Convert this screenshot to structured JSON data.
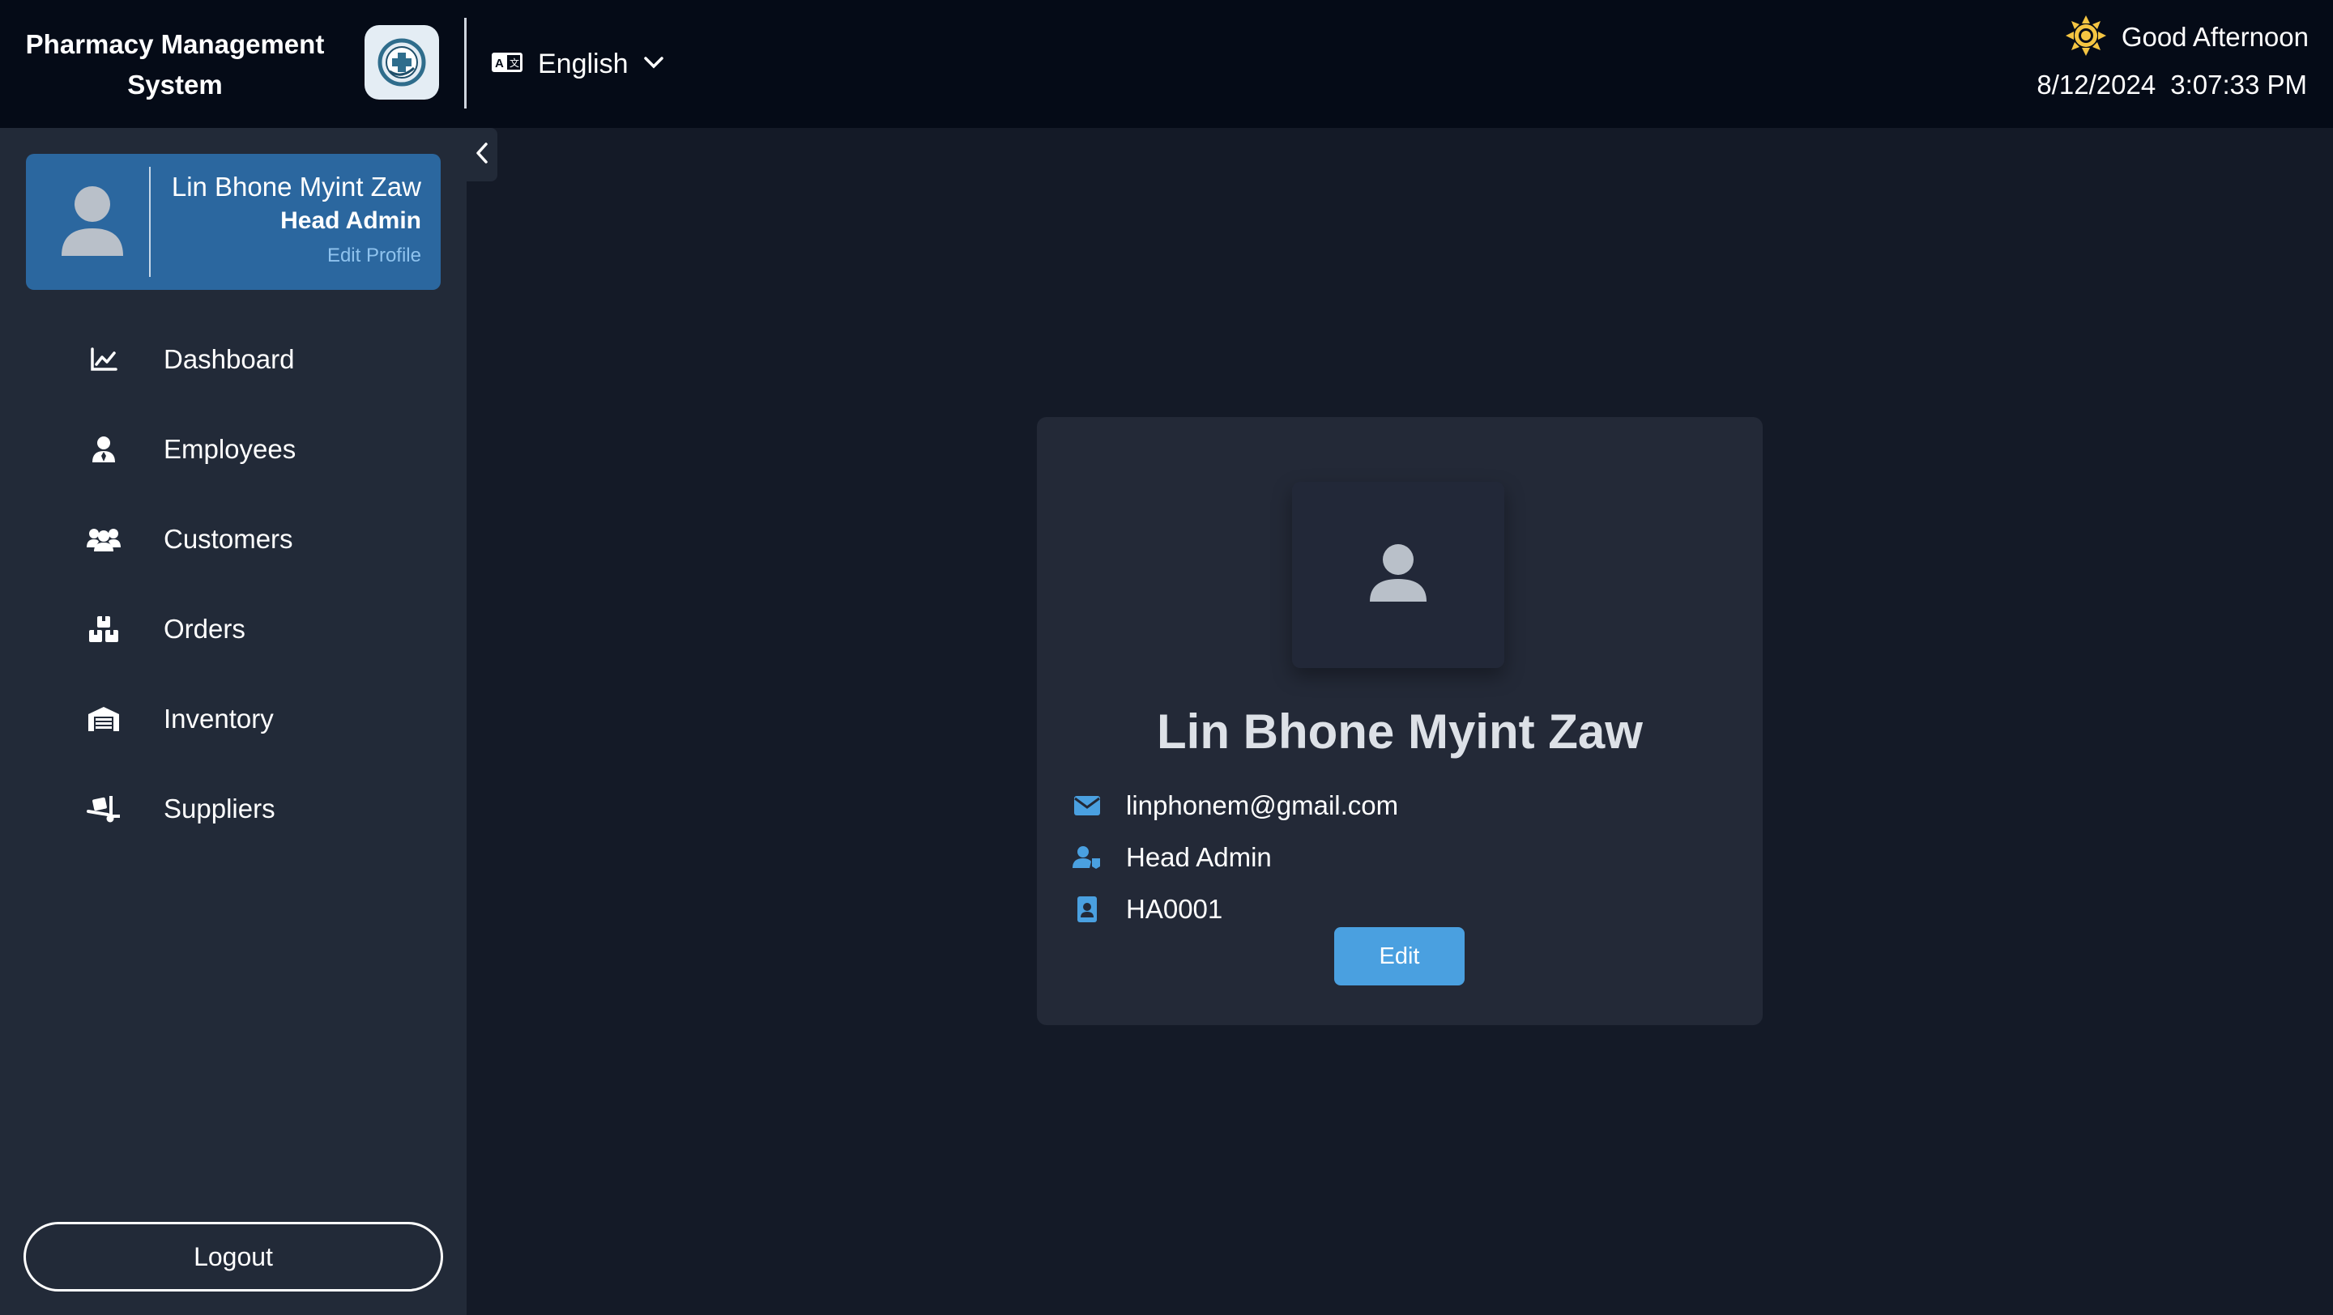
{
  "header": {
    "app_title_line1": "Pharmacy Management",
    "app_title_line2": "System",
    "logo_icon": "pharmacy-logo-icon",
    "language": {
      "icon": "language-icon",
      "selected": "English"
    },
    "greeting": {
      "icon": "sun-icon",
      "text": "Good Afternoon"
    },
    "date": "8/12/2024",
    "time": "3:07:33 PM"
  },
  "sidebar": {
    "profile": {
      "name": "Lin Bhone Myint Zaw",
      "role": "Head Admin",
      "edit_label": "Edit Profile"
    },
    "items": [
      {
        "label": "Dashboard",
        "icon": "chart-line-icon"
      },
      {
        "label": "Employees",
        "icon": "employee-icon"
      },
      {
        "label": "Customers",
        "icon": "users-icon"
      },
      {
        "label": "Orders",
        "icon": "boxes-icon"
      },
      {
        "label": "Inventory",
        "icon": "warehouse-icon"
      },
      {
        "label": "Suppliers",
        "icon": "dolly-icon"
      }
    ],
    "logout_label": "Logout"
  },
  "profile_card": {
    "name": "Lin Bhone Myint Zaw",
    "email": "linphonem@gmail.com",
    "role": "Head Admin",
    "employee_id": "HA0001",
    "edit_label": "Edit"
  },
  "colors": {
    "topbar_bg": "#050b17",
    "sidebar_bg": "#222a38",
    "main_bg": "#141a27",
    "profile_card_bg": "#2b679f",
    "accent": "#4aa0e0",
    "sun": "#f5c542"
  }
}
